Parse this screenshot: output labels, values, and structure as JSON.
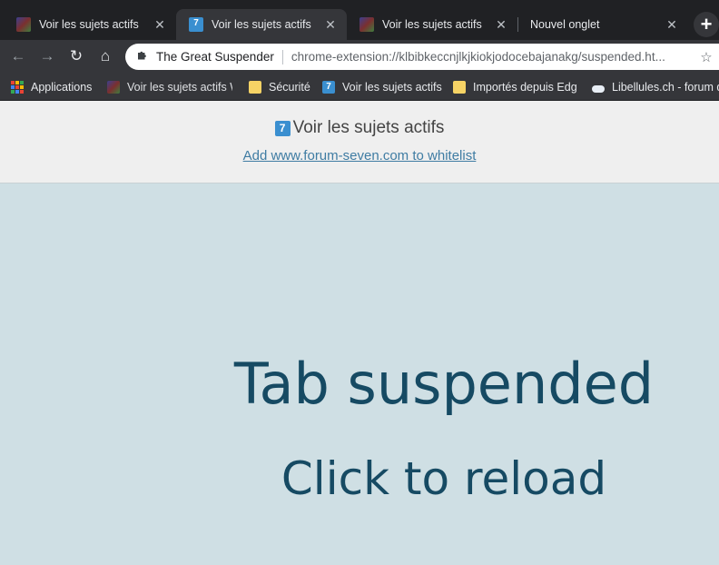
{
  "tabs": [
    {
      "title": "Voir les sujets actifs",
      "favicon": "forum-six-favicon",
      "close": "✕",
      "active": false
    },
    {
      "title": "Voir les sujets actifs",
      "favicon": "forum-seven-favicon",
      "close": "✕",
      "active": true
    },
    {
      "title": "Voir les sujets actifs",
      "favicon": "forum-six-favicon",
      "close": "✕",
      "active": false
    },
    {
      "title": "Nouvel onglet",
      "favicon": "",
      "close": "✕",
      "active": false
    }
  ],
  "new_tab_label": "+",
  "toolbar": {
    "back": "←",
    "forward": "→",
    "reload": "↻",
    "home": "⌂",
    "omnibox": {
      "site": "The Great Suspender",
      "url": "chrome-extension://klbibkeccnjlkjkiokjodocebajanakg/suspended.ht...",
      "star": "☆"
    }
  },
  "bookmarks": [
    {
      "label": "Applications",
      "icon": "apps-grid-icon"
    },
    {
      "label": "Voir les sujets actifs W",
      "icon": "forum-six-favicon"
    },
    {
      "label": "Sécurité",
      "icon": "folder-icon"
    },
    {
      "label": "Voir les sujets actifs",
      "icon": "forum-seven-favicon"
    },
    {
      "label": "Importés depuis Edge",
      "icon": "folder-icon"
    },
    {
      "label": "Libellules.ch - forum d",
      "icon": "libellules-favicon"
    }
  ],
  "suspended": {
    "page_title": "Voir les sujets actifs",
    "title_icon": "7",
    "whitelist_link": "Add www.forum-seven.com to whitelist",
    "heading": "Tab suspended",
    "subheading": "Click to reload"
  },
  "colors": {
    "chrome_dark": "#202124",
    "chrome_toolbar": "#35363a",
    "page_bg": "#cfdfe4",
    "heading_color": "#164a63",
    "link_color": "#3f7ca3"
  }
}
